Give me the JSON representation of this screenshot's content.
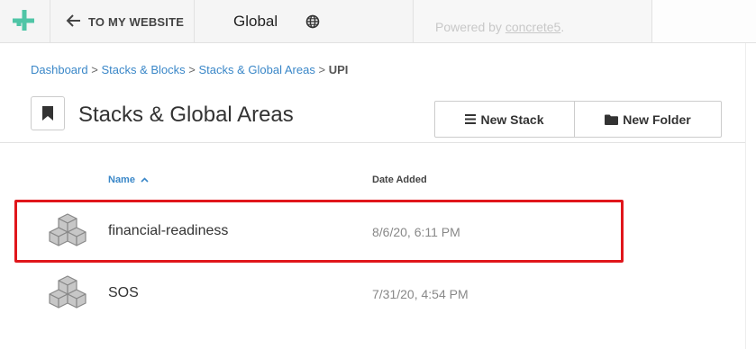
{
  "toolbar": {
    "back_label": "TO MY WEBSITE",
    "site_title": "Global",
    "powered_prefix": "Powered by ",
    "powered_link": "concrete5",
    "powered_suffix": "."
  },
  "breadcrumb": {
    "items": [
      "Dashboard",
      "Stacks & Blocks",
      "Stacks & Global Areas"
    ],
    "current": "UPI",
    "separator": ">"
  },
  "page": {
    "title": "Stacks & Global Areas",
    "new_stack_label": "New Stack",
    "new_folder_label": "New Folder"
  },
  "table": {
    "columns": [
      "Name",
      "Date Added"
    ],
    "sort_indicator": "ascending",
    "rows": [
      {
        "name": "financial-readiness",
        "date": "8/6/20, 6:11 PM",
        "icon": "stack-cubes-icon",
        "highlighted": true
      },
      {
        "name": "SOS",
        "date": "7/31/20, 4:54 PM",
        "icon": "stack-cubes-icon",
        "highlighted": false
      }
    ]
  },
  "colors": {
    "brand_accent": "#4fc5a6",
    "link": "#3a87c8",
    "highlight": "#e0161b"
  }
}
